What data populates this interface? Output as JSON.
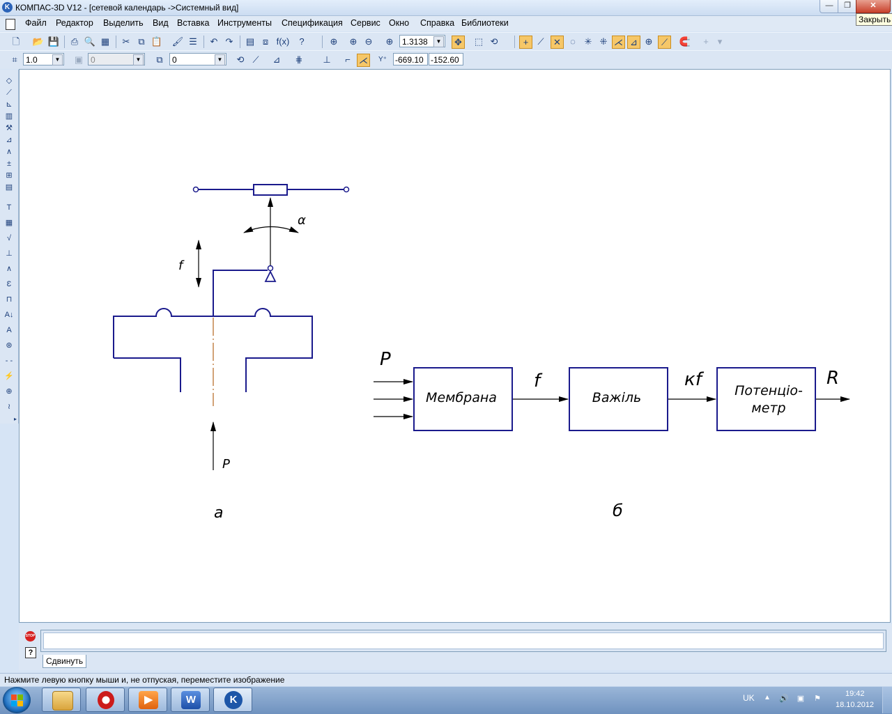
{
  "window": {
    "title": "КОМПАС-3D V12 - [сетевой календарь ->Системный вид]",
    "app_icon_letter": "K",
    "minimize": "—",
    "maximize": "❐",
    "close": "✕",
    "close_tooltip": "Закрыть"
  },
  "menu": [
    "Файл",
    "Редактор",
    "Выделить",
    "Вид",
    "Вставка",
    "Инструменты",
    "Спецификация",
    "Сервис",
    "Окно",
    "Справка",
    "Библиотеки"
  ],
  "toolbar1": {
    "zoom_value": "1.3138"
  },
  "toolbar2": {
    "step_value": "1.0",
    "layer_value": "0",
    "style_value": "0",
    "coord_x": "-669.10",
    "coord_y": "-152.60"
  },
  "drawing": {
    "left_labels": {
      "alpha": "α",
      "f": "f",
      "p": "P",
      "caption": "а"
    },
    "block_diagram": {
      "input_label": "P",
      "blocks": [
        {
          "line1": "Мембрана",
          "line2": ""
        },
        {
          "line1": "Важіль",
          "line2": ""
        },
        {
          "line1": "Потенціо-",
          "line2": "метр"
        }
      ],
      "links": [
        "f",
        "кf"
      ],
      "output_label": "R",
      "caption": "б"
    }
  },
  "property_bar": {
    "tab_label": "Сдвинуть",
    "stop_label": "STOP",
    "help_label": "?"
  },
  "status": {
    "text": "Нажмите левую кнопку мыши и, не отпуская, переместите изображение"
  },
  "taskbar": {
    "apps": [
      "explorer-icon",
      "opera-icon",
      "media-player-icon",
      "word-icon",
      "kompas-icon"
    ],
    "language": "UK",
    "time": "19:42",
    "date": "18.10.2012"
  },
  "colors": {
    "drawing_line": "#1a1a8c",
    "axis_line": "#b5651d",
    "canvas": "#ffffff",
    "close_button": "#c8402a"
  }
}
